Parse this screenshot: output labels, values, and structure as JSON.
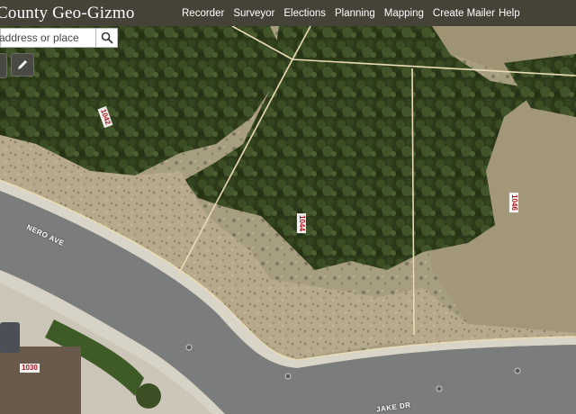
{
  "header": {
    "title": "County Geo-Gizmo",
    "nav": [
      "Recorder",
      "Surveyor",
      "Elections",
      "Planning",
      "Mapping",
      "Create Mailer",
      "Help"
    ]
  },
  "search": {
    "placeholder": "address or place"
  },
  "map": {
    "lot_labels": [
      "1042",
      "1044",
      "1046",
      "1030"
    ],
    "street_labels": [
      "NERO AVE",
      "JAKE DR"
    ]
  }
}
